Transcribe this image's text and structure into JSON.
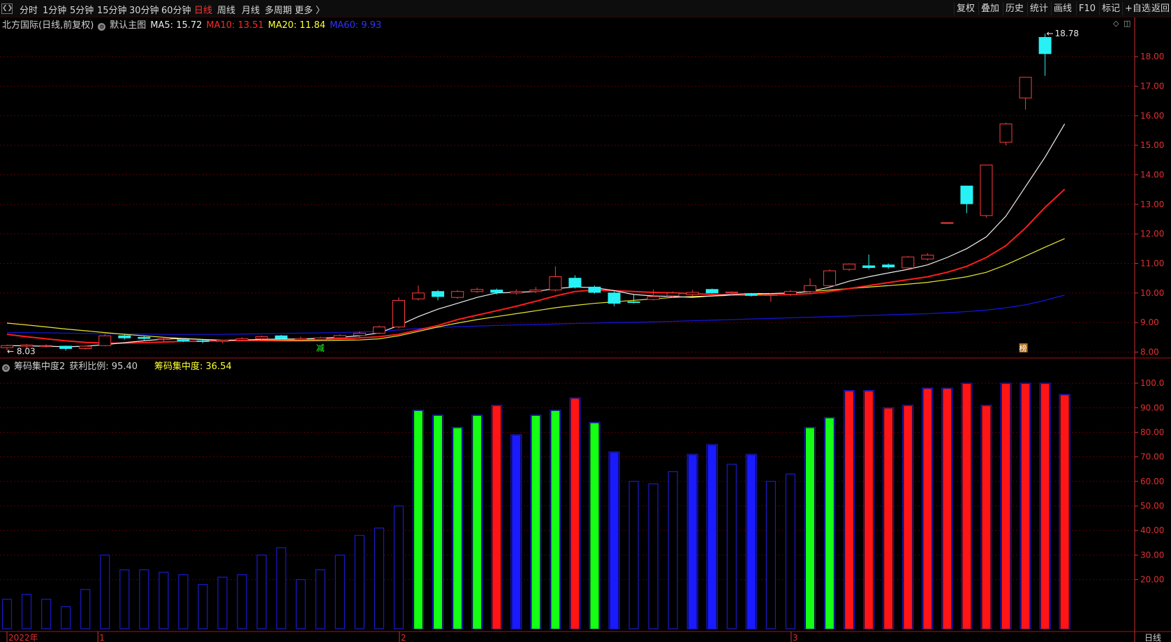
{
  "toolbar": {
    "periods": [
      "分时",
      "1分钟",
      "5分钟",
      "15分钟",
      "30分钟",
      "60分钟",
      "日线",
      "周线",
      "月线",
      "多周期",
      "更多 〉"
    ],
    "active_period": "日线",
    "right_buttons": [
      "复权",
      "叠加",
      "历史",
      "统计",
      "画线",
      "F10",
      "标记",
      "+自选",
      "返回"
    ]
  },
  "main_legend": {
    "stock": "北方国际(日线,前复权)",
    "template": "默认主图",
    "ma5": "MA5: 15.72",
    "ma10": "MA10: 13.51",
    "ma20": "MA20: 11.84",
    "ma60": "MA60: 9.93",
    "colors": {
      "ma5": "#ffffff",
      "ma10": "#ff2020",
      "ma20": "#ffff30",
      "ma60": "#2020ff",
      "text": "#d0d0d0"
    }
  },
  "price_axis": {
    "ticks": [
      "18.00",
      "17.00",
      "16.00",
      "15.00",
      "14.00",
      "13.00",
      "12.00",
      "11.00",
      "10.00",
      "9.00",
      "8.00"
    ],
    "min": 7.8,
    "max": 18.9
  },
  "price_annotations": {
    "high": "18.78",
    "low": "8.03",
    "marker_a": "减",
    "marker_b": "榜"
  },
  "sub_legend": {
    "name": "筹码集中度2",
    "profit": "获利比例: 95.40",
    "concentration": "筹码集中度: 36.54"
  },
  "sub_axis": {
    "ticks": [
      "100.0",
      "90.00",
      "80.00",
      "70.00",
      "60.00",
      "50.00",
      "40.00",
      "30.00",
      "20.00"
    ],
    "min": 0,
    "max": 104
  },
  "date_axis": {
    "labels": [
      "2022年",
      "1",
      "2",
      "3"
    ],
    "period_label": "日线"
  },
  "chart_data": {
    "type": "candlestick",
    "candles": [
      {
        "o": 8.15,
        "h": 8.25,
        "l": 8.05,
        "c": 8.22,
        "u": 1
      },
      {
        "o": 8.2,
        "h": 8.28,
        "l": 8.12,
        "c": 8.24,
        "u": 1
      },
      {
        "o": 8.22,
        "h": 8.26,
        "l": 8.15,
        "c": 8.2,
        "u": 1
      },
      {
        "o": 8.2,
        "h": 8.22,
        "l": 8.05,
        "c": 8.12,
        "u": 0
      },
      {
        "o": 8.12,
        "h": 8.22,
        "l": 8.08,
        "c": 8.2,
        "u": 1
      },
      {
        "o": 8.22,
        "h": 8.6,
        "l": 8.2,
        "c": 8.55,
        "u": 1
      },
      {
        "o": 8.55,
        "h": 8.6,
        "l": 8.42,
        "c": 8.48,
        "u": 0
      },
      {
        "o": 8.5,
        "h": 8.55,
        "l": 8.4,
        "c": 8.46,
        "u": 0
      },
      {
        "o": 8.45,
        "h": 8.5,
        "l": 8.35,
        "c": 8.42,
        "u": 1
      },
      {
        "o": 8.42,
        "h": 8.48,
        "l": 8.34,
        "c": 8.38,
        "u": 0
      },
      {
        "o": 8.38,
        "h": 8.42,
        "l": 8.3,
        "c": 8.36,
        "u": 0
      },
      {
        "o": 8.36,
        "h": 8.42,
        "l": 8.3,
        "c": 8.4,
        "u": 1
      },
      {
        "o": 8.4,
        "h": 8.5,
        "l": 8.36,
        "c": 8.45,
        "u": 1
      },
      {
        "o": 8.45,
        "h": 8.56,
        "l": 8.4,
        "c": 8.52,
        "u": 1
      },
      {
        "o": 8.55,
        "h": 8.58,
        "l": 8.42,
        "c": 8.46,
        "u": 0
      },
      {
        "o": 8.46,
        "h": 8.52,
        "l": 8.38,
        "c": 8.42,
        "u": 1
      },
      {
        "o": 8.42,
        "h": 8.52,
        "l": 8.4,
        "c": 8.48,
        "u": 1
      },
      {
        "o": 8.48,
        "h": 8.6,
        "l": 8.44,
        "c": 8.56,
        "u": 1
      },
      {
        "o": 8.56,
        "h": 8.7,
        "l": 8.5,
        "c": 8.64,
        "u": 1
      },
      {
        "o": 8.64,
        "h": 8.9,
        "l": 8.6,
        "c": 8.85,
        "u": 1
      },
      {
        "o": 8.85,
        "h": 9.85,
        "l": 8.8,
        "c": 9.75,
        "u": 1
      },
      {
        "o": 9.8,
        "h": 10.25,
        "l": 9.75,
        "c": 10.0,
        "u": 1
      },
      {
        "o": 10.05,
        "h": 10.1,
        "l": 9.75,
        "c": 9.88,
        "u": 0
      },
      {
        "o": 9.85,
        "h": 10.1,
        "l": 9.8,
        "c": 10.05,
        "u": 1
      },
      {
        "o": 10.05,
        "h": 10.18,
        "l": 10.0,
        "c": 10.12,
        "u": 1
      },
      {
        "o": 10.1,
        "h": 10.15,
        "l": 9.95,
        "c": 10.02,
        "u": 0
      },
      {
        "o": 10.0,
        "h": 10.12,
        "l": 9.95,
        "c": 10.05,
        "u": 1
      },
      {
        "o": 10.05,
        "h": 10.2,
        "l": 10.0,
        "c": 10.1,
        "u": 1
      },
      {
        "o": 10.1,
        "h": 10.9,
        "l": 10.05,
        "c": 10.55,
        "u": 1
      },
      {
        "o": 10.5,
        "h": 10.6,
        "l": 10.15,
        "c": 10.2,
        "u": 0
      },
      {
        "o": 10.2,
        "h": 10.25,
        "l": 9.98,
        "c": 10.02,
        "u": 0
      },
      {
        "o": 10.0,
        "h": 10.05,
        "l": 9.55,
        "c": 9.65,
        "u": 0
      },
      {
        "o": 9.7,
        "h": 9.98,
        "l": 9.65,
        "c": 9.7,
        "u": 0
      },
      {
        "o": 9.78,
        "h": 10.12,
        "l": 9.75,
        "c": 9.88,
        "u": 1
      },
      {
        "o": 9.9,
        "h": 10.05,
        "l": 9.85,
        "c": 10.0,
        "u": 1
      },
      {
        "o": 9.95,
        "h": 10.1,
        "l": 9.9,
        "c": 10.02,
        "u": 1
      },
      {
        "o": 10.12,
        "h": 10.15,
        "l": 9.98,
        "c": 10.0,
        "u": 0
      },
      {
        "o": 10.0,
        "h": 10.05,
        "l": 9.92,
        "c": 10.03,
        "u": 1
      },
      {
        "o": 9.98,
        "h": 10.0,
        "l": 9.88,
        "c": 9.92,
        "u": 0
      },
      {
        "o": 9.92,
        "h": 10.0,
        "l": 9.7,
        "c": 9.95,
        "u": 1
      },
      {
        "o": 9.95,
        "h": 10.1,
        "l": 9.9,
        "c": 10.05,
        "u": 1
      },
      {
        "o": 10.05,
        "h": 10.5,
        "l": 10.0,
        "c": 10.25,
        "u": 1
      },
      {
        "o": 10.25,
        "h": 10.8,
        "l": 10.2,
        "c": 10.75,
        "u": 1
      },
      {
        "o": 10.8,
        "h": 11.0,
        "l": 10.75,
        "c": 10.98,
        "u": 1
      },
      {
        "o": 10.92,
        "h": 11.3,
        "l": 10.8,
        "c": 10.86,
        "u": 0
      },
      {
        "o": 10.95,
        "h": 11.0,
        "l": 10.82,
        "c": 10.88,
        "u": 0
      },
      {
        "o": 10.85,
        "h": 11.25,
        "l": 10.8,
        "c": 11.22,
        "u": 1
      },
      {
        "o": 11.15,
        "h": 11.35,
        "l": 11.1,
        "c": 11.28,
        "u": 1
      },
      {
        "o": 12.38,
        "h": 12.38,
        "l": 12.38,
        "c": 12.38,
        "u": 1
      },
      {
        "o": 13.62,
        "h": 13.62,
        "l": 12.7,
        "c": 13.02,
        "u": 0
      },
      {
        "o": 12.62,
        "h": 14.33,
        "l": 12.55,
        "c": 14.33,
        "u": 1
      },
      {
        "o": 15.1,
        "h": 15.76,
        "l": 15.0,
        "c": 15.72,
        "u": 1
      },
      {
        "o": 16.6,
        "h": 17.3,
        "l": 16.2,
        "c": 17.3,
        "u": 1
      },
      {
        "o": 18.65,
        "h": 18.78,
        "l": 17.35,
        "c": 18.1,
        "u": 0
      }
    ],
    "ma5": [
      8.22,
      8.21,
      8.2,
      8.18,
      8.2,
      8.25,
      8.32,
      8.38,
      8.44,
      8.46,
      8.42,
      8.4,
      8.41,
      8.43,
      8.44,
      8.44,
      8.47,
      8.5,
      8.55,
      8.65,
      8.9,
      9.2,
      9.45,
      9.65,
      9.85,
      10.0,
      10.02,
      10.05,
      10.15,
      10.2,
      10.18,
      10.08,
      9.95,
      9.9,
      9.88,
      9.85,
      9.9,
      9.95,
      9.98,
      9.98,
      10.0,
      10.05,
      10.2,
      10.4,
      10.55,
      10.68,
      10.8,
      10.95,
      11.2,
      11.5,
      11.9,
      12.6,
      13.6,
      14.6,
      15.72
    ],
    "ma10": [
      8.6,
      8.52,
      8.45,
      8.38,
      8.33,
      8.3,
      8.3,
      8.32,
      8.34,
      8.36,
      8.37,
      8.38,
      8.39,
      8.4,
      8.41,
      8.42,
      8.43,
      8.45,
      8.48,
      8.52,
      8.6,
      8.75,
      8.9,
      9.1,
      9.25,
      9.4,
      9.55,
      9.72,
      9.9,
      10.05,
      10.1,
      10.08,
      10.05,
      10.02,
      10.0,
      9.98,
      9.95,
      9.93,
      9.92,
      9.93,
      9.95,
      9.98,
      10.05,
      10.15,
      10.25,
      10.35,
      10.45,
      10.55,
      10.7,
      10.9,
      11.2,
      11.6,
      12.2,
      12.9,
      13.51
    ],
    "ma20": [
      8.98,
      8.92,
      8.85,
      8.78,
      8.72,
      8.66,
      8.6,
      8.55,
      8.5,
      8.46,
      8.43,
      8.4,
      8.39,
      8.38,
      8.38,
      8.38,
      8.39,
      8.4,
      8.41,
      8.45,
      8.55,
      8.7,
      8.85,
      8.98,
      9.1,
      9.2,
      9.3,
      9.4,
      9.5,
      9.58,
      9.65,
      9.7,
      9.75,
      9.8,
      9.85,
      9.88,
      9.9,
      9.92,
      9.95,
      9.98,
      10.0,
      10.05,
      10.1,
      10.15,
      10.2,
      10.25,
      10.3,
      10.36,
      10.45,
      10.55,
      10.7,
      10.95,
      11.25,
      11.55,
      11.84
    ],
    "ma60": [
      8.66,
      8.66,
      8.65,
      8.64,
      8.63,
      8.62,
      8.62,
      8.61,
      8.6,
      8.6,
      8.6,
      8.6,
      8.61,
      8.62,
      8.63,
      8.64,
      8.65,
      8.66,
      8.68,
      8.7,
      8.75,
      8.8,
      8.83,
      8.86,
      8.88,
      8.9,
      8.92,
      8.93,
      8.95,
      8.97,
      8.98,
      9.0,
      9.01,
      9.02,
      9.04,
      9.06,
      9.08,
      9.1,
      9.12,
      9.14,
      9.16,
      9.18,
      9.2,
      9.22,
      9.24,
      9.26,
      9.28,
      9.3,
      9.33,
      9.37,
      9.42,
      9.5,
      9.6,
      9.75,
      9.93
    ],
    "sub_bars": [
      {
        "v": 12,
        "c": "blue-hollow"
      },
      {
        "v": 14,
        "c": "blue-hollow"
      },
      {
        "v": 12,
        "c": "blue-hollow"
      },
      {
        "v": 9,
        "c": "blue-hollow"
      },
      {
        "v": 16,
        "c": "blue-hollow"
      },
      {
        "v": 30,
        "c": "blue-hollow"
      },
      {
        "v": 24,
        "c": "blue-hollow"
      },
      {
        "v": 24,
        "c": "blue-hollow"
      },
      {
        "v": 23,
        "c": "blue-hollow"
      },
      {
        "v": 22,
        "c": "blue-hollow"
      },
      {
        "v": 18,
        "c": "blue-hollow"
      },
      {
        "v": 21,
        "c": "blue-hollow"
      },
      {
        "v": 22,
        "c": "blue-hollow"
      },
      {
        "v": 30,
        "c": "blue-hollow"
      },
      {
        "v": 33,
        "c": "blue-hollow"
      },
      {
        "v": 20,
        "c": "blue-hollow"
      },
      {
        "v": 24,
        "c": "blue-hollow"
      },
      {
        "v": 30,
        "c": "blue-hollow"
      },
      {
        "v": 38,
        "c": "blue-hollow"
      },
      {
        "v": 41,
        "c": "blue-hollow"
      },
      {
        "v": 50,
        "c": "blue-hollow"
      },
      {
        "v": 89,
        "c": "green"
      },
      {
        "v": 87,
        "c": "green"
      },
      {
        "v": 82,
        "c": "green"
      },
      {
        "v": 87,
        "c": "green"
      },
      {
        "v": 91,
        "c": "red"
      },
      {
        "v": 79,
        "c": "blue"
      },
      {
        "v": 87,
        "c": "green"
      },
      {
        "v": 89,
        "c": "green"
      },
      {
        "v": 94,
        "c": "red"
      },
      {
        "v": 84,
        "c": "green"
      },
      {
        "v": 72,
        "c": "blue"
      },
      {
        "v": 60,
        "c": "blue-hollow"
      },
      {
        "v": 59,
        "c": "blue-hollow"
      },
      {
        "v": 64,
        "c": "blue-hollow"
      },
      {
        "v": 71,
        "c": "blue"
      },
      {
        "v": 75,
        "c": "blue"
      },
      {
        "v": 67,
        "c": "blue-hollow"
      },
      {
        "v": 71,
        "c": "blue"
      },
      {
        "v": 60,
        "c": "blue-hollow"
      },
      {
        "v": 63,
        "c": "blue-hollow"
      },
      {
        "v": 82,
        "c": "green"
      },
      {
        "v": 86,
        "c": "green"
      },
      {
        "v": 97,
        "c": "red"
      },
      {
        "v": 97,
        "c": "red"
      },
      {
        "v": 90,
        "c": "red"
      },
      {
        "v": 91,
        "c": "red"
      },
      {
        "v": 98,
        "c": "red"
      },
      {
        "v": 98,
        "c": "red"
      },
      {
        "v": 100,
        "c": "red"
      },
      {
        "v": 91,
        "c": "red"
      },
      {
        "v": 100,
        "c": "red"
      },
      {
        "v": 100,
        "c": "red"
      },
      {
        "v": 100,
        "c": "red"
      },
      {
        "v": 95.4,
        "c": "red"
      }
    ],
    "colors": {
      "up": "#ff3c3c",
      "down": "#27f1f5",
      "green": "#15ff15",
      "red": "#ff1515",
      "blue": "#1a1aff",
      "grid": "#5a0000",
      "axis": "#d23232"
    }
  }
}
